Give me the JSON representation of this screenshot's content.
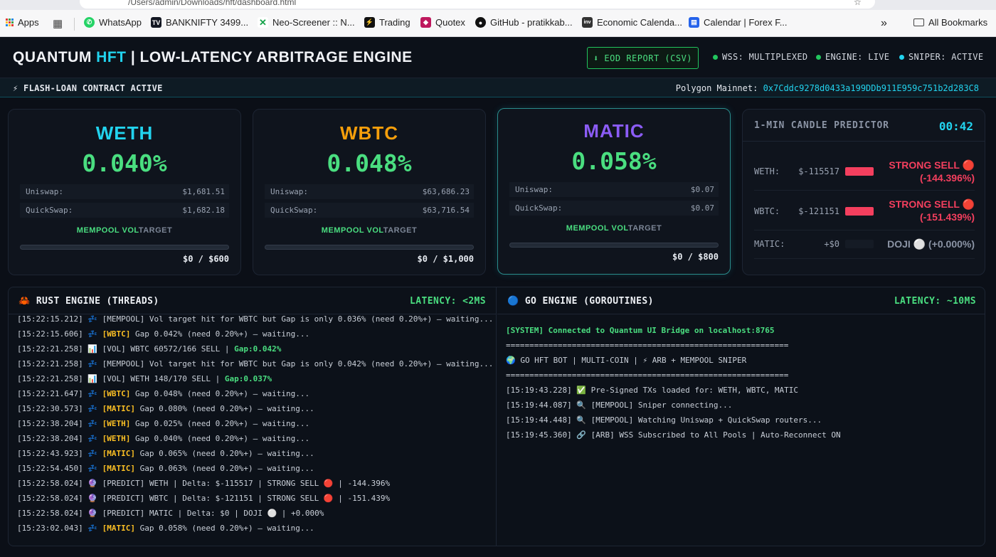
{
  "browser": {
    "url": "/Users/admin/Downloads/hft/dashboard.html",
    "bookmarks": [
      "Apps",
      "WhatsApp",
      "BANKNIFTY 3499...",
      "Neo-Screener :: N...",
      "Trading",
      "Quotex",
      "GitHub - pratikkab...",
      "Economic Calenda...",
      "Calendar | Forex F..."
    ],
    "all_bookmarks": "All Bookmarks",
    "more": "»"
  },
  "header": {
    "brand": "QUANTUM",
    "brand_accent": "HFT",
    "subtitle": "| LOW-LATENCY ARBITRAGE ENGINE",
    "report_button": "⬇ EOD REPORT (CSV)",
    "statuses": [
      {
        "label": "WSS: MULTIPLEXED",
        "color": "#22c55e"
      },
      {
        "label": "ENGINE: LIVE",
        "color": "#22c55e"
      },
      {
        "label": "SNIPER: ACTIVE",
        "color": "#22d3ee"
      }
    ]
  },
  "flashbar": {
    "left": "⚡ FLASH-LOAN CONTRACT ACTIVE",
    "network": "Polygon Mainnet:",
    "address": "0x7Cddc9278d0433a199DDb911E959c751b2d283C8"
  },
  "cards": [
    {
      "coin": "WETH",
      "color": "#22d3ee",
      "pct": "0.040%",
      "uniswap_label": "Uniswap:",
      "uniswap": "$1,681.51",
      "quickswap_label": "QuickSwap:",
      "quickswap": "$1,682.18",
      "mempool_a": "MEMPOOL VOL",
      "mempool_b": "TARGET",
      "progress": 0,
      "target": "$0 / $600"
    },
    {
      "coin": "WBTC",
      "color": "#f59e0b",
      "pct": "0.048%",
      "uniswap_label": "Uniswap:",
      "uniswap": "$63,686.23",
      "quickswap_label": "QuickSwap:",
      "quickswap": "$63,716.54",
      "mempool_a": "MEMPOOL VOL",
      "mempool_b": "TARGET",
      "progress": 0,
      "target": "$0 / $1,000"
    },
    {
      "coin": "MATIC",
      "color": "#8b5cf6",
      "pct": "0.058%",
      "uniswap_label": "Uniswap:",
      "uniswap": "$0.07",
      "quickswap_label": "QuickSwap:",
      "quickswap": "$0.07",
      "mempool_a": "MEMPOOL VOL",
      "mempool_b": "TARGET",
      "progress": 0,
      "target": "$0 / $800"
    }
  ],
  "predictor": {
    "title": "1-MIN CANDLE PREDICTOR",
    "timer": "00:42",
    "rows": [
      {
        "name": "WETH:",
        "delta": "$-115517",
        "bar_color": "#f43f5e",
        "signal": "STRONG SELL 🔴",
        "pct": "(-144.396%)",
        "signal_color": "#f43f5e"
      },
      {
        "name": "WBTC:",
        "delta": "$-121151",
        "bar_color": "#f43f5e",
        "signal": "STRONG SELL 🔴",
        "pct": "(-151.439%)",
        "signal_color": "#f43f5e"
      },
      {
        "name": "MATIC:",
        "delta": "+$0",
        "bar_color": "#151b25",
        "signal": "DOJI ⚪",
        "pct": "(+0.000%)",
        "signal_color": "#8b94a5"
      }
    ]
  },
  "rust": {
    "title": "🦀 RUST ENGINE (THREADS)",
    "latency": "LATENCY: <2MS",
    "lines": [
      {
        "ts": "[15:22:15.212]",
        "icon": "💤",
        "tag": "",
        "text": " [MEMPOOL] Vol target hit for WBTC but Gap is only 0.036% (need 0.20%+) — waiting...",
        "hl": ""
      },
      {
        "ts": "[15:22:15.606]",
        "icon": "💤",
        "tag": "[WBTC]",
        "text": " Gap 0.042% (need 0.20%+) — waiting...",
        "hl": ""
      },
      {
        "ts": "[15:22:21.258]",
        "icon": "📊",
        "tag": "",
        "text": " [VOL] WBTC 60572/166 SELL | ",
        "hl": "Gap:0.042%"
      },
      {
        "ts": "[15:22:21.258]",
        "icon": "💤",
        "tag": "",
        "text": " [MEMPOOL] Vol target hit for WBTC but Gap is only 0.042% (need 0.20%+) — waiting...",
        "hl": ""
      },
      {
        "ts": "[15:22:21.258]",
        "icon": "📊",
        "tag": "",
        "text": " [VOL] WETH 148/170 SELL | ",
        "hl": "Gap:0.037%"
      },
      {
        "ts": "[15:22:21.647]",
        "icon": "💤",
        "tag": "[WBTC]",
        "text": " Gap 0.048% (need 0.20%+) — waiting...",
        "hl": ""
      },
      {
        "ts": "[15:22:30.573]",
        "icon": "💤",
        "tag": "[MATIC]",
        "text": " Gap 0.080% (need 0.20%+) — waiting...",
        "hl": ""
      },
      {
        "ts": "[15:22:38.204]",
        "icon": "💤",
        "tag": "[WETH]",
        "text": " Gap 0.025% (need 0.20%+) — waiting...",
        "hl": ""
      },
      {
        "ts": "[15:22:38.204]",
        "icon": "💤",
        "tag": "[WETH]",
        "text": " Gap 0.040% (need 0.20%+) — waiting...",
        "hl": ""
      },
      {
        "ts": "[15:22:43.923]",
        "icon": "💤",
        "tag": "[MATIC]",
        "text": " Gap 0.065% (need 0.20%+) — waiting...",
        "hl": ""
      },
      {
        "ts": "[15:22:54.450]",
        "icon": "💤",
        "tag": "[MATIC]",
        "text": " Gap 0.063% (need 0.20%+) — waiting...",
        "hl": ""
      },
      {
        "ts": "[15:22:58.024]",
        "icon": "🔮",
        "tag": "",
        "text": " [PREDICT] WETH | Delta: $-115517 | STRONG SELL 🔴 | -144.396%",
        "hl": ""
      },
      {
        "ts": "[15:22:58.024]",
        "icon": "🔮",
        "tag": "",
        "text": " [PREDICT] WBTC | Delta: $-121151 | STRONG SELL 🔴 | -151.439%",
        "hl": ""
      },
      {
        "ts": "[15:22:58.024]",
        "icon": "🔮",
        "tag": "",
        "text": " [PREDICT] MATIC | Delta: $0 | DOJI ⚪ | +0.000%",
        "hl": ""
      },
      {
        "ts": "[15:23:02.043]",
        "icon": "💤",
        "tag": "[MATIC]",
        "text": " Gap 0.058% (need 0.20%+) — waiting...",
        "hl": ""
      }
    ]
  },
  "go": {
    "title": "🔵 GO ENGINE (GOROUTINES)",
    "latency": "LATENCY: ~10MS",
    "system_line": "[SYSTEM] Connected to Quantum UI Bridge on localhost:8765",
    "rule": "============================================================",
    "banner": "🌍 GO HFT BOT | MULTI-COIN | ⚡ ARB + MEMPOOL SNIPER",
    "lines": [
      "[15:19:43.228] ✅ Pre-Signed TXs loaded for: WETH, WBTC, MATIC",
      "[15:19:44.087] 🔍 [MEMPOOL] Sniper connecting...",
      "[15:19:44.448] 🔍 [MEMPOOL] Watching Uniswap + QuickSwap routers...",
      "[15:19:45.360] 🔗 [ARB] WSS Subscribed to All Pools | Auto-Reconnect ON"
    ]
  }
}
